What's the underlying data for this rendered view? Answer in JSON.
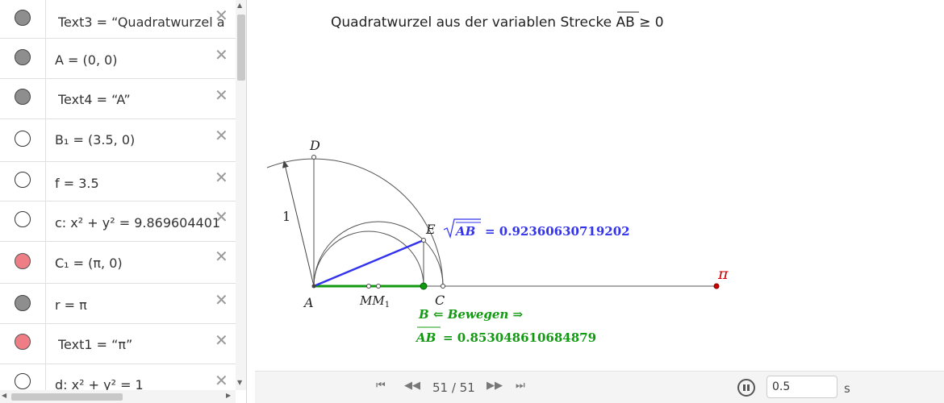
{
  "algebra": {
    "rows": [
      {
        "text": "Text3  =  “Quadratwurzel a",
        "marble": "gray"
      },
      {
        "text": "A = (0, 0)",
        "marble": "gray"
      },
      {
        "text": "Text4  =  “A”",
        "marble": "gray"
      },
      {
        "text": "B₁ = (3.5, 0)",
        "marble": "off"
      },
      {
        "text": "f = 3.5",
        "marble": "off"
      },
      {
        "text": "c: x² + y² = 9.869604401",
        "marble": "off"
      },
      {
        "text": "C₁ = (π, 0)",
        "marble": "red"
      },
      {
        "text": "r = π",
        "marble": "gray"
      },
      {
        "text": "Text1  =  “π”",
        "marble": "red"
      },
      {
        "text": "d: x² + y² = 1",
        "marble": "off"
      }
    ],
    "delete_symbol": "✕"
  },
  "graphics": {
    "title_prefix": "Quadratwurzel aus der variablen Strecke ",
    "title_segment": "AB",
    "title_suffix": " ≥ 0",
    "label_D": "D",
    "label_E": "E",
    "label_A": "A",
    "label_C": "C",
    "label_M": "MM",
    "label_M_sub": "1",
    "label_pi": "π",
    "label_one": "1",
    "sqrt_radicand": "AB",
    "sqrt_value": "= 0.92360630719202",
    "move_text": "B  ⇐  Bewegen  ⇒",
    "ab_segment": "AB",
    "ab_value": "= 0.853048610684879",
    "colors": {
      "blue": "#3333ee",
      "green": "#119911",
      "red": "#cc0000",
      "gray": "#555555"
    }
  },
  "player": {
    "counter": "51 / 51",
    "speed": "0.5",
    "unit": "s"
  }
}
